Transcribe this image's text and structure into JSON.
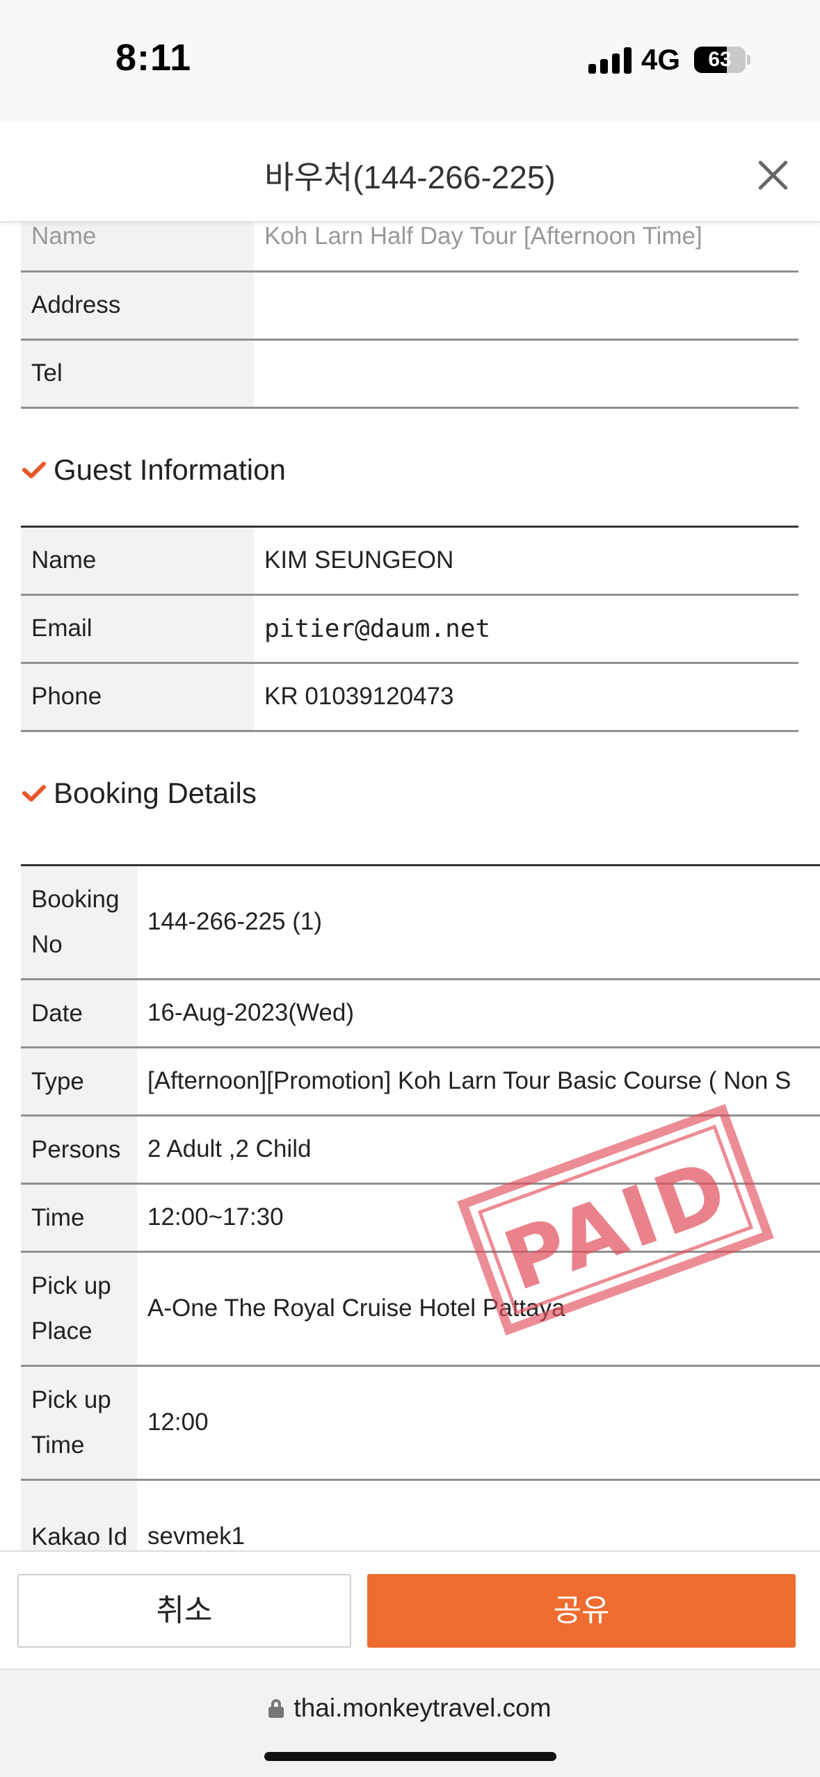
{
  "status_bar": {
    "time": "8:11",
    "network": "4G",
    "battery": "63",
    "battery_level": 0.63
  },
  "modal": {
    "title": "바우처(144-266-225)",
    "close_icon": "close-icon"
  },
  "place_info": {
    "rows": [
      {
        "label": "Name",
        "value": "Koh Larn Half Day Tour [Afternoon Time]"
      },
      {
        "label": "Address",
        "value": ""
      },
      {
        "label": "Tel",
        "value": ""
      }
    ]
  },
  "guest_info": {
    "heading": "Guest Information",
    "icon": "check-icon",
    "rows": [
      {
        "label": "Name",
        "value": "KIM SEUNGEON"
      },
      {
        "label": "Email",
        "value": "pitier@daum.net"
      },
      {
        "label": "Phone",
        "value": "KR 01039120473"
      }
    ]
  },
  "booking_details": {
    "heading": "Booking Details",
    "icon": "check-icon",
    "rows": [
      {
        "label": "Booking No",
        "value": "144-266-225 (1)"
      },
      {
        "label": "Date",
        "value": "16-Aug-2023(Wed)"
      },
      {
        "label": "Type",
        "value": "[Afternoon][Promotion] Koh Larn Tour Basic Course ( Non S"
      },
      {
        "label": "Persons",
        "value": "2 Adult ,2 Child"
      },
      {
        "label": "Time",
        "value": "12:00~17:30"
      },
      {
        "label": "Pick up Place",
        "value": "A-One The Royal Cruise Hotel Pattaya"
      },
      {
        "label": "Pick up Time",
        "value": "12:00"
      },
      {
        "label": "Kakao Id",
        "value": "sevmek1"
      }
    ]
  },
  "stamp": {
    "text": "PAID",
    "color": "#e24e5c"
  },
  "buttons": {
    "cancel": "취소",
    "share": "공유",
    "share_color": "#ee6c2f"
  },
  "browser": {
    "url": "thai.monkeytravel.com",
    "lock_icon": "lock-icon"
  }
}
